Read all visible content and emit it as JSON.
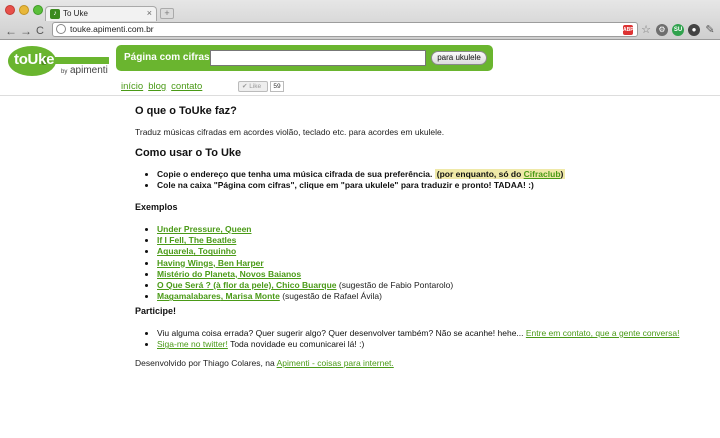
{
  "browser": {
    "tab_title": "To Uke",
    "tab_favicon": "♪",
    "close_glyph": "×",
    "newtab_glyph": "+",
    "back_glyph": "←",
    "forward_glyph": "→",
    "reload_glyph": "C",
    "url": "touke.apimenti.com.br",
    "extensions": {
      "abp": "ABP",
      "su": "SU"
    }
  },
  "logo": {
    "word": "toUke",
    "by": "by",
    "brand": "apimenti"
  },
  "search": {
    "label": "Página com cifras:",
    "value": "",
    "placeholder": "",
    "button_label": "para ukulele"
  },
  "nav": {
    "items": [
      {
        "label": "início"
      },
      {
        "label": "blog"
      },
      {
        "label": "contato"
      }
    ],
    "like_label": "✔ Like",
    "like_count": "59"
  },
  "content": {
    "what_title": "O que o ToUke faz?",
    "what_text": "Traduz músicas cifradas em acordes violão, teclado etc. para acordes em ukulele.",
    "how_title": "Como usar o To Uke",
    "how_step1": "Copie o endereço que tenha uma música cifrada de sua preferência.",
    "how_step1_note": "(por enquanto, só do ",
    "how_step1_link": "Cifraclub",
    "how_step1_close": ")",
    "how_step2": "Cole na caixa \"Página com cifras\", clique em \"para ukulele\" para traduzir e pronto! TADAA! :)",
    "examples_title": "Exemplos",
    "examples": [
      {
        "song": "Under Pressure",
        "artist": ", Queen",
        "note": ""
      },
      {
        "song": "If I Fell",
        "artist": ", The Beatles",
        "note": ""
      },
      {
        "song": "Aquarela",
        "artist": ", Toquinho",
        "note": ""
      },
      {
        "song": "Having Wings",
        "artist": ", Ben Harper",
        "note": ""
      },
      {
        "song": "Mistério do Planeta",
        "artist": ", Novos Baianos",
        "note": ""
      },
      {
        "song": "O Que Será ? (à flor da pele)",
        "artist": ", Chico Buarque",
        "note": " (sugestão de Fabio Pontarolo)"
      },
      {
        "song": "Magamalabares",
        "artist": ", Marisa Monte",
        "note": " (sugestão de Rafael Ávila)"
      }
    ],
    "participe_title": "Participe!",
    "participe_1_text": "Viu alguma coisa errada? Quer sugerir algo? Quer desenvolver também? Não se acanhe! hehe... ",
    "participe_1_link": "Entre em contato, que a gente conversa!",
    "participe_2_link": "Siga-me no twitter!",
    "participe_2_text": " Toda novidade eu comunicarei lá! :)",
    "footer_text": "Desenvolvido por Thiago Colares, na ",
    "footer_link": "Apimenti - coisas para internet."
  },
  "colors": {
    "accent_green": "#6ab52f",
    "link_green": "#4a9a17",
    "highlight": "#efe9a8"
  }
}
